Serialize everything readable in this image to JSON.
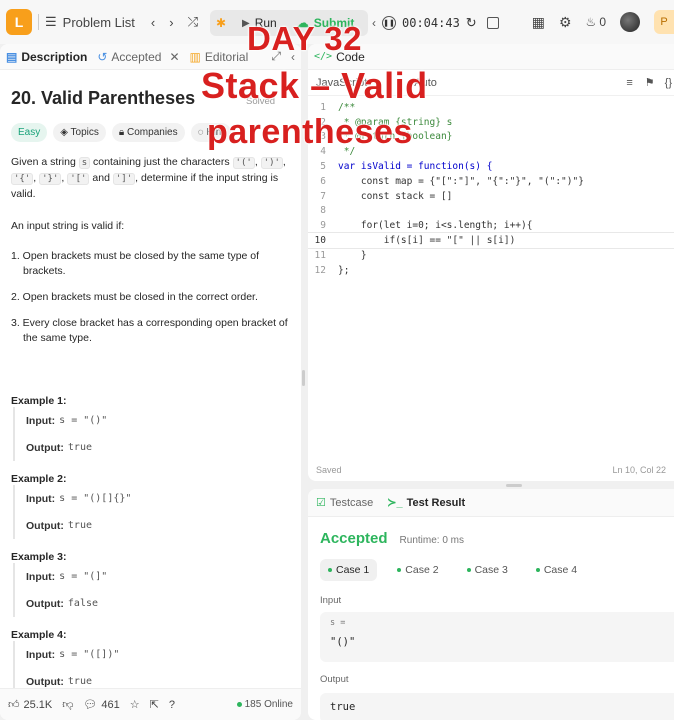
{
  "overlay": {
    "line1": "DAY 32",
    "line2": "Stack – Valid",
    "line3": "parentheses"
  },
  "topbar": {
    "problem_list_label": "Problem List",
    "run_label": "Run",
    "submit_label": "Submit",
    "timer": "00:04:43",
    "coins": "0",
    "premium_label": "P"
  },
  "left_tabs": [
    {
      "label": "Description"
    },
    {
      "label": "Accepted"
    },
    {
      "label": "Editorial"
    }
  ],
  "problem": {
    "title": "20. Valid Parentheses",
    "solved_label": "Solved",
    "difficulty": "Easy",
    "chips": [
      "Topics",
      "Companies",
      "Hint"
    ],
    "desc_1": "Given a string",
    "desc_var": "s",
    "desc_2": "containing just the characters",
    "chars": [
      "'('",
      "')'",
      "'{'",
      "'}'",
      "'['",
      "']'"
    ],
    "desc_and": "and",
    "desc_3": ", determine if the input string is valid.",
    "rules_intro": "An input string is valid if:",
    "rules": [
      "1. Open brackets must be closed by the same type of brackets.",
      "2. Open brackets must be closed in the correct order.",
      "3. Every close bracket has a corresponding open bracket of the same type."
    ],
    "examples": [
      {
        "title": "Example 1:",
        "input": "s = \"()\"",
        "output": "true"
      },
      {
        "title": "Example 2:",
        "input": "s = \"()[]{}\"",
        "output": "true"
      },
      {
        "title": "Example 3:",
        "input": "s = \"(]\"",
        "output": "false"
      },
      {
        "title": "Example 4:",
        "input": "s = \"([])\"",
        "output": "true"
      }
    ],
    "input_label": "Input:",
    "output_label": "Output:"
  },
  "footer": {
    "likes": "25.1K",
    "comments": "461",
    "online": "185 Online"
  },
  "code_panel": {
    "title": "Code",
    "language": "JavaScript",
    "auto_label": "Auto",
    "saved_label": "Saved",
    "cursor_label": "Ln 10, Col 22",
    "lines": [
      "/**",
      " * @param {string} s",
      " * @return {boolean}",
      " */",
      "var isValid = function(s) {",
      "    const map = {\"[\":\"]\", \"{\":\"}\", \"(\":\")\"}",
      "    const stack = []",
      "",
      "    for(let i=0; i<s.length; i++){",
      "        if(s[i] == \"[\" || s[i])",
      "    }",
      "};"
    ]
  },
  "result_panel": {
    "tabs": [
      "Testcase",
      "Test Result"
    ],
    "status": "Accepted",
    "runtime": "Runtime: 0 ms",
    "cases": [
      "Case 1",
      "Case 2",
      "Case 3",
      "Case 4"
    ],
    "input_label": "Input",
    "var_name": "s =",
    "input_value": "\"()\"",
    "output_label": "Output",
    "output_value": "true"
  },
  "colors": {
    "accent_green": "#2db55d",
    "overlay_red": "#d8201f",
    "logo_orange": "#f89f1b"
  }
}
